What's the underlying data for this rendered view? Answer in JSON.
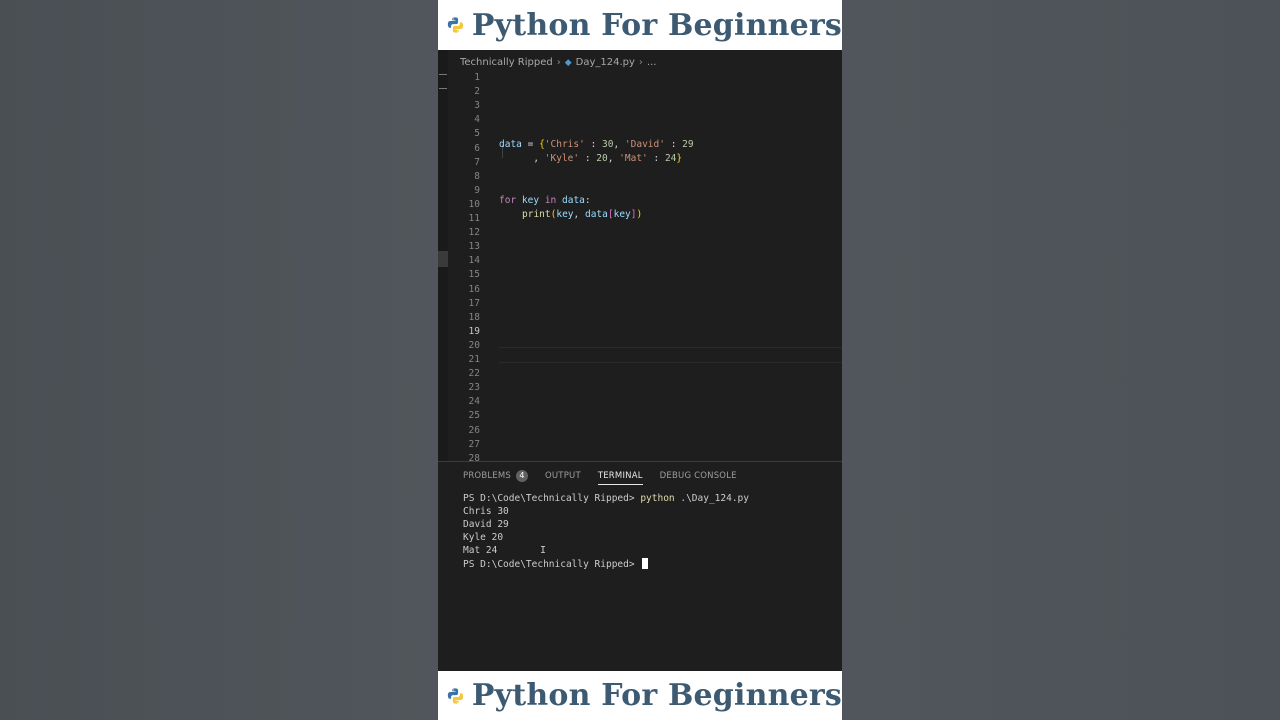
{
  "banner": {
    "title": "Python For Beginners"
  },
  "breadcrumb": {
    "folder": "Technically Ripped",
    "file": "Day_124.py",
    "more": "..."
  },
  "editor": {
    "line_numbers": [
      "1",
      "2",
      "3",
      "4",
      "5",
      "6",
      "7",
      "8",
      "9",
      "10",
      "11",
      "12",
      "13",
      "14",
      "15",
      "16",
      "17",
      "18",
      "19",
      "20",
      "21",
      "22",
      "23",
      "24",
      "25",
      "26",
      "27",
      "28"
    ],
    "active_line": "19",
    "code": {
      "l5": {
        "var": "data",
        "eq": " = ",
        "brace_open": "{",
        "s1": "'Chris'",
        "c1": " : ",
        "n1": "30",
        "comma1": ", ",
        "s2": "'David'",
        "c2": " : ",
        "n2": "29"
      },
      "l6": {
        "lead": "      , ",
        "s3": "'Kyle'",
        "c3": " : ",
        "n3": "20",
        "comma2": ", ",
        "s4": "'Mat'",
        "c4": " : ",
        "n4": "24",
        "brace_close": "}"
      },
      "l9": {
        "kw_for": "for",
        "sp1": " ",
        "var_key": "key",
        "sp2": " ",
        "kw_in": "in",
        "sp3": " ",
        "var_data": "data",
        "colon": ":"
      },
      "l10": {
        "fn": "print",
        "p_open": "(",
        "arg1": "key",
        "comma": ", ",
        "arg2": "data",
        "b_open": "[",
        "arg3": "key",
        "b_close": "]",
        "p_close": ")"
      }
    }
  },
  "panel": {
    "tabs": [
      {
        "label": "PROBLEMS",
        "badge": "4"
      },
      {
        "label": "OUTPUT"
      },
      {
        "label": "TERMINAL"
      },
      {
        "label": "DEBUG CONSOLE"
      }
    ],
    "active_tab": "TERMINAL",
    "terminal": {
      "prompt1": "PS D:\\Code\\Technically Ripped> ",
      "command": "python",
      "command_arg": " .\\Day_124.py",
      "output": [
        "Chris 30",
        "David 29",
        "Kyle 20",
        "Mat 24"
      ],
      "prompt2": "PS D:\\Code\\Technically Ripped> "
    }
  },
  "colors": {
    "banner_text": "#3d5a73",
    "editor_bg": "#1e1e1e",
    "python_blue": "#3b73a8",
    "python_yellow": "#f2c73c"
  },
  "icons": [
    "python-logo-icon",
    "python-file-icon",
    "chevron-right-icon",
    "text-cursor-icon"
  ]
}
